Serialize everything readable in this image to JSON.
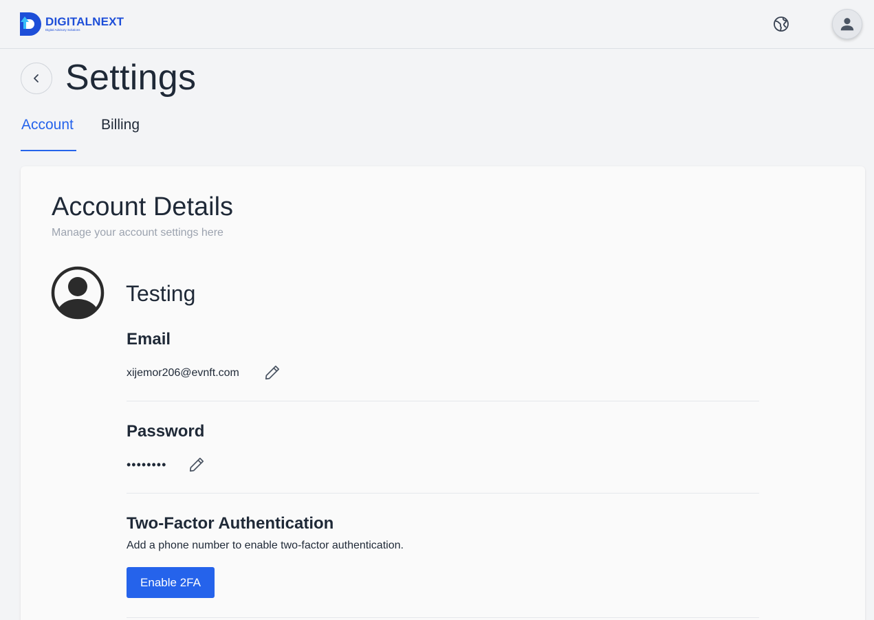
{
  "header": {
    "logo_name": "DIGITALNEXT",
    "logo_tagline": "Digital Advisory Solutions",
    "icons": {
      "language": "globe-icon",
      "account": "user-icon"
    }
  },
  "page": {
    "title": "Settings",
    "back_icon": "chevron-left-icon"
  },
  "tabs": [
    {
      "label": "Account",
      "active": true
    },
    {
      "label": "Billing",
      "active": false
    }
  ],
  "account": {
    "title": "Account Details",
    "subtitle": "Manage your account settings here",
    "user_name": "Testing",
    "email": {
      "label": "Email",
      "value": "xijemor206@evnft.com",
      "edit_icon": "pencil-icon"
    },
    "password": {
      "label": "Password",
      "value": "••••••••",
      "edit_icon": "pencil-icon"
    },
    "two_factor": {
      "label": "Two-Factor Authentication",
      "description": "Add a phone number to enable two-factor authentication.",
      "button_label": "Enable 2FA"
    }
  },
  "colors": {
    "accent": "#2563eb",
    "brand": "#1d4ed8",
    "background": "#f3f4f6",
    "card": "#fafafa",
    "muted_text": "#9ca3af"
  }
}
